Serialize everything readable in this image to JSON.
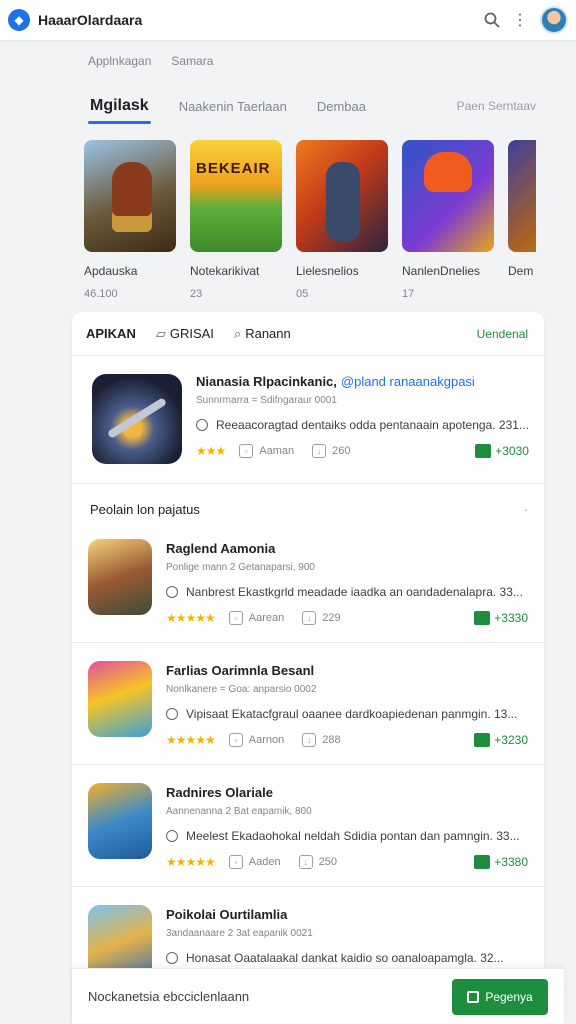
{
  "app": {
    "title": "HaaarOlardaara"
  },
  "breadcrumbs": [
    "Applnkagan",
    "Samara"
  ],
  "tabs": [
    {
      "label": "Mgilask",
      "active": true
    },
    {
      "label": "Naakenin Taerlaan",
      "active": false
    },
    {
      "label": "Dembaa",
      "active": false
    }
  ],
  "tabs_right": "Paen Serntaav",
  "carousel": [
    {
      "title": "Apdauska",
      "sub": "46.100",
      "icon": "game-art-warrior"
    },
    {
      "title": "Notekarikivat",
      "sub": "23",
      "icon": "game-art-bekeair"
    },
    {
      "title": "Lielesnelios",
      "sub": "05",
      "icon": "game-art-soldier"
    },
    {
      "title": "NanlenDnelies",
      "sub": "17",
      "icon": "game-art-hero"
    },
    {
      "title": "Dem",
      "sub": "",
      "icon": "game-art-partial"
    }
  ],
  "filters": {
    "f1": "APIKAN",
    "f2": "GRISAI",
    "f3": "Ranann",
    "right": "Uendenal"
  },
  "featured": {
    "title": "Nianasia Rlpacinkanic,",
    "link": "@pland ranaanakgpasi",
    "meta": "Sunnrmarra = Sdifngaraur 0001",
    "desc": "Reeaacoragtad dentaiks odda pentanaain apotenga. 231...",
    "author": "Aaman",
    "downloads": "260",
    "price": "+3030"
  },
  "section_title": "Peolain lon pajatus",
  "rows": [
    {
      "title": "Raglend Aamonia",
      "meta": "Ponlige mann 2 Getanaparsi, 900",
      "desc": "Nanbrest Ekastkgrld meadade iaadka an oandadenalapra. 33...",
      "author": "Aarean",
      "downloads": "229",
      "price": "+3330"
    },
    {
      "title": "Farlias Oarimnla Besanl",
      "meta": "Nonlkanere = Goa: anparsio 0002",
      "desc": "Vipisaat Ekatacfgraul oaanee dardkoapiedenan panmgin. 13...",
      "author": "Aarnon",
      "downloads": "288",
      "price": "+3230"
    },
    {
      "title": "Radnires Olariale",
      "meta": "Aannenanna 2 Bat eapamik, 800",
      "desc": "Meelest Ekadaohokal neldah Sdidia pontan dan pamngin. 33...",
      "author": "Aaden",
      "downloads": "250",
      "price": "+3380"
    },
    {
      "title": "Poikolai Ourtilamlia",
      "meta": "3andaanaare 2 3at eapanik 0021",
      "desc": "Honasat Oaatalaakal dankat kaidio so oanaloapamgla. 32...",
      "author": "",
      "downloads": "",
      "price": ""
    }
  ],
  "bottombar": {
    "text": "Nockanetsia ebcciclenlaann",
    "button": "Pegenya"
  },
  "colors": {
    "accent": "#1a73e8",
    "green": "#1e8e3e",
    "star": "#f4b400"
  }
}
